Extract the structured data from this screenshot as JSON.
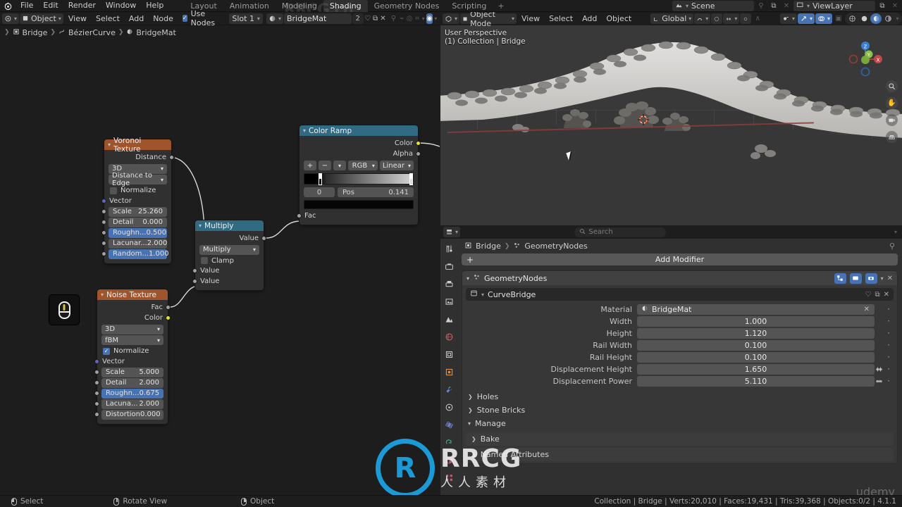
{
  "topbar": {
    "logo_icon": "blender-logo-icon",
    "menus": [
      "File",
      "Edit",
      "Render",
      "Window",
      "Help"
    ],
    "workspaces": [
      {
        "label": "Layout",
        "active": false
      },
      {
        "label": "Animation",
        "active": false
      },
      {
        "label": "Modeling",
        "active": false
      },
      {
        "label": "Shading",
        "active": true
      },
      {
        "label": "Geometry Nodes",
        "active": false
      },
      {
        "label": "Scripting",
        "active": false
      },
      {
        "label": "+",
        "active": false
      }
    ],
    "scene_name": "Scene",
    "viewlayer_name": "ViewLayer"
  },
  "shader_editor": {
    "mode": "Object",
    "menus": [
      "View",
      "Select",
      "Add",
      "Node"
    ],
    "use_nodes_label": "Use Nodes",
    "use_nodes_checked": true,
    "slot": "Slot 1",
    "material": "BridgeMat",
    "user_count": "2",
    "breadcrumb": [
      "Bridge",
      "BézierCurve",
      "BridgeMat"
    ]
  },
  "nodes": {
    "voronoi": {
      "title": "Voronoi Texture",
      "outputs": [
        "Distance"
      ],
      "dropdowns": [
        "3D",
        "Distance to Edge"
      ],
      "normalize_label": "Normalize",
      "normalize_checked": false,
      "vector_label": "Vector",
      "fields": [
        {
          "label": "Scale",
          "value": "25.260",
          "highlight": false
        },
        {
          "label": "Detail",
          "value": "0.000",
          "highlight": false
        },
        {
          "label": "Roughn...",
          "value": "0.500",
          "highlight": true
        },
        {
          "label": "Lacunar...",
          "value": "2.000",
          "highlight": false
        },
        {
          "label": "Random...",
          "value": "1.000",
          "highlight": true
        }
      ]
    },
    "noise": {
      "title": "Noise Texture",
      "outputs": [
        "Fac",
        "Color"
      ],
      "dropdowns": [
        "3D",
        "fBM"
      ],
      "normalize_label": "Normalize",
      "normalize_checked": true,
      "vector_label": "Vector",
      "fields": [
        {
          "label": "Scale",
          "value": "5.000",
          "highlight": false
        },
        {
          "label": "Detail",
          "value": "2.000",
          "highlight": false
        },
        {
          "label": "Roughn...",
          "value": "0.675",
          "highlight": true
        },
        {
          "label": "Lacuna...",
          "value": "2.000",
          "highlight": false
        },
        {
          "label": "Distortion",
          "value": "0.000",
          "highlight": false
        }
      ]
    },
    "multiply": {
      "title": "Multiply",
      "output": "Value",
      "operation": "Multiply",
      "clamp_label": "Clamp",
      "clamp_checked": false,
      "inputs": [
        "Value",
        "Value"
      ]
    },
    "colorramp": {
      "title": "Color Ramp",
      "outputs": [
        "Color",
        "Alpha"
      ],
      "add_btn": "+",
      "remove_btn": "−",
      "color_mode": "RGB",
      "interpolation": "Linear",
      "index": "0",
      "pos_label": "Pos",
      "pos_value": "0.141",
      "input": "Fac"
    }
  },
  "viewport": {
    "mode": "Object Mode",
    "menus": [
      "View",
      "Select",
      "Add",
      "Object"
    ],
    "transform_orientation": "Global",
    "overlay_line1": "User Perspective",
    "overlay_line2": "(1) Collection | Bridge",
    "gizmo_axes": [
      "X",
      "Y",
      "Z"
    ],
    "nav_tools": [
      "zoom-icon",
      "hand-icon",
      "camera-icon",
      "grid-icon"
    ]
  },
  "properties": {
    "search_placeholder": "Search",
    "breadcrumb": [
      "Bridge",
      "GeometryNodes"
    ],
    "add_modifier": "Add Modifier",
    "modifier_name": "GeometryNodes",
    "node_group_name": "CurveBridge",
    "rows": [
      {
        "label": "Material",
        "value": "BridgeMat",
        "type": "material"
      },
      {
        "label": "Width",
        "value": "1.000",
        "type": "number",
        "anim": false
      },
      {
        "label": "Height",
        "value": "1.120",
        "type": "number",
        "anim": false
      },
      {
        "label": "Rail Width",
        "value": "0.100",
        "type": "number",
        "anim": false
      },
      {
        "label": "Rail Height",
        "value": "0.100",
        "type": "number",
        "anim": false
      },
      {
        "label": "Displacement Height",
        "value": "1.650",
        "type": "number",
        "anim": true
      },
      {
        "label": "Displacement Power",
        "value": "5.110",
        "type": "number",
        "anim": true
      }
    ],
    "panels": [
      {
        "label": "Holes",
        "open": false,
        "boxed": false
      },
      {
        "label": "Stone Bricks",
        "open": false,
        "boxed": false
      },
      {
        "label": "Manage",
        "open": true,
        "boxed": false
      },
      {
        "label": "Bake",
        "open": false,
        "boxed": true
      },
      {
        "label": "Named Attributes",
        "open": false,
        "boxed": true
      }
    ]
  },
  "statusbar": {
    "hints": [
      {
        "icon": "lmb-icon",
        "label": "Select"
      },
      {
        "icon": "mmb-icon",
        "label": "Rotate View"
      },
      {
        "icon": "rmb-icon",
        "label": "Object"
      }
    ],
    "stats": "Collection | Bridge | Verts:20,010 | Faces:19,431 | Tris:39,368 | Objects:0/2 | 4.1.1"
  },
  "watermarks": {
    "brand_main": "RRCG",
    "brand_sub": "人人素材",
    "brand_ring": "R",
    "corner": "RRCG.cn",
    "course": "udemy"
  },
  "colors": {
    "accent_blue": "#4772b3",
    "texture_node_header": "#a0542c",
    "converter_node_header": "#316b83",
    "panel_bg": "#303030",
    "editor_bg": "#1d1d1d"
  }
}
